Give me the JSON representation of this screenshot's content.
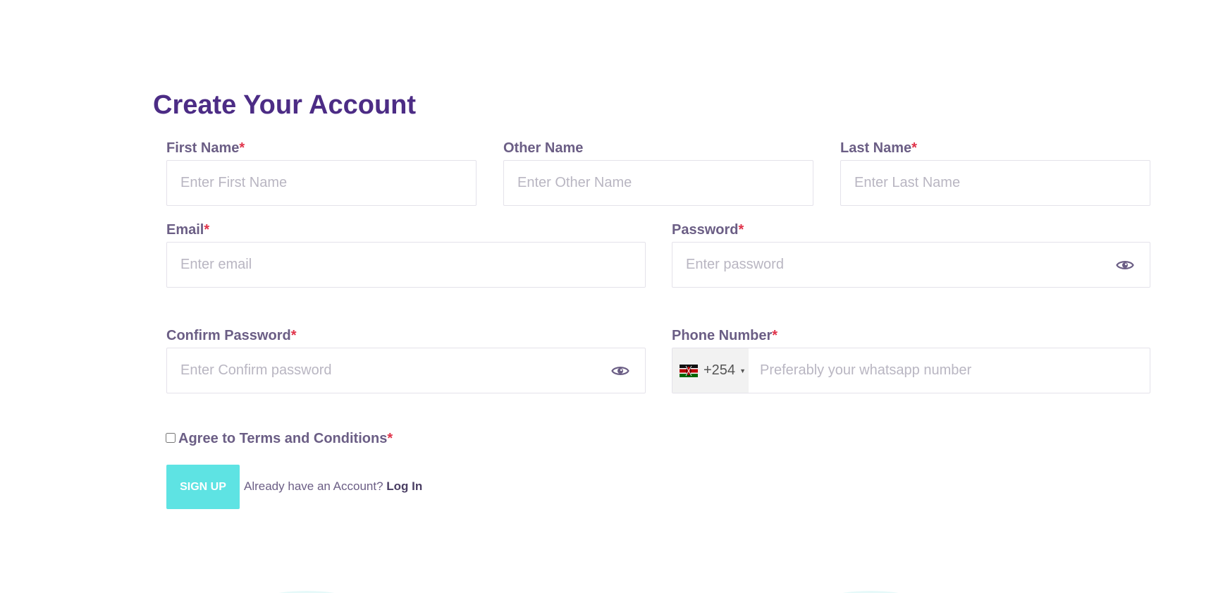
{
  "form": {
    "title": "Create Your Account",
    "first_name": {
      "label": "First Name",
      "required_mark": "*",
      "placeholder": "Enter First Name"
    },
    "other_name": {
      "label": "Other Name",
      "placeholder": "Enter Other Name"
    },
    "last_name": {
      "label": "Last Name",
      "required_mark": "*",
      "placeholder": "Enter Last Name"
    },
    "email": {
      "label": "Email",
      "required_mark": "*",
      "placeholder": "Enter email"
    },
    "password": {
      "label": "Password",
      "required_mark": "*",
      "placeholder": "Enter password",
      "toggle_icon": "eye-icon"
    },
    "confirm_password": {
      "label": "Confirm Password",
      "required_mark": "*",
      "placeholder": "Enter Confirm password",
      "toggle_icon": "eye-icon"
    },
    "phone": {
      "label": "Phone Number",
      "required_mark": "*",
      "country_flag": "kenya-flag-icon",
      "dial_code": "+254",
      "placeholder": "Preferably your whatsapp number"
    },
    "terms": {
      "label": "Agree to Terms and Conditions",
      "required_mark": "*",
      "checked": false
    },
    "signup_label": "SIGN UP",
    "login_prompt": "Already have an Account?",
    "login_link": "Log In"
  },
  "colors": {
    "title": "#4c2c85",
    "label": "#6b5e85",
    "required": "#e0334a",
    "button": "#5ee3e3",
    "input_border": "#e4e2ea",
    "placeholder": "#b9b6c2"
  }
}
